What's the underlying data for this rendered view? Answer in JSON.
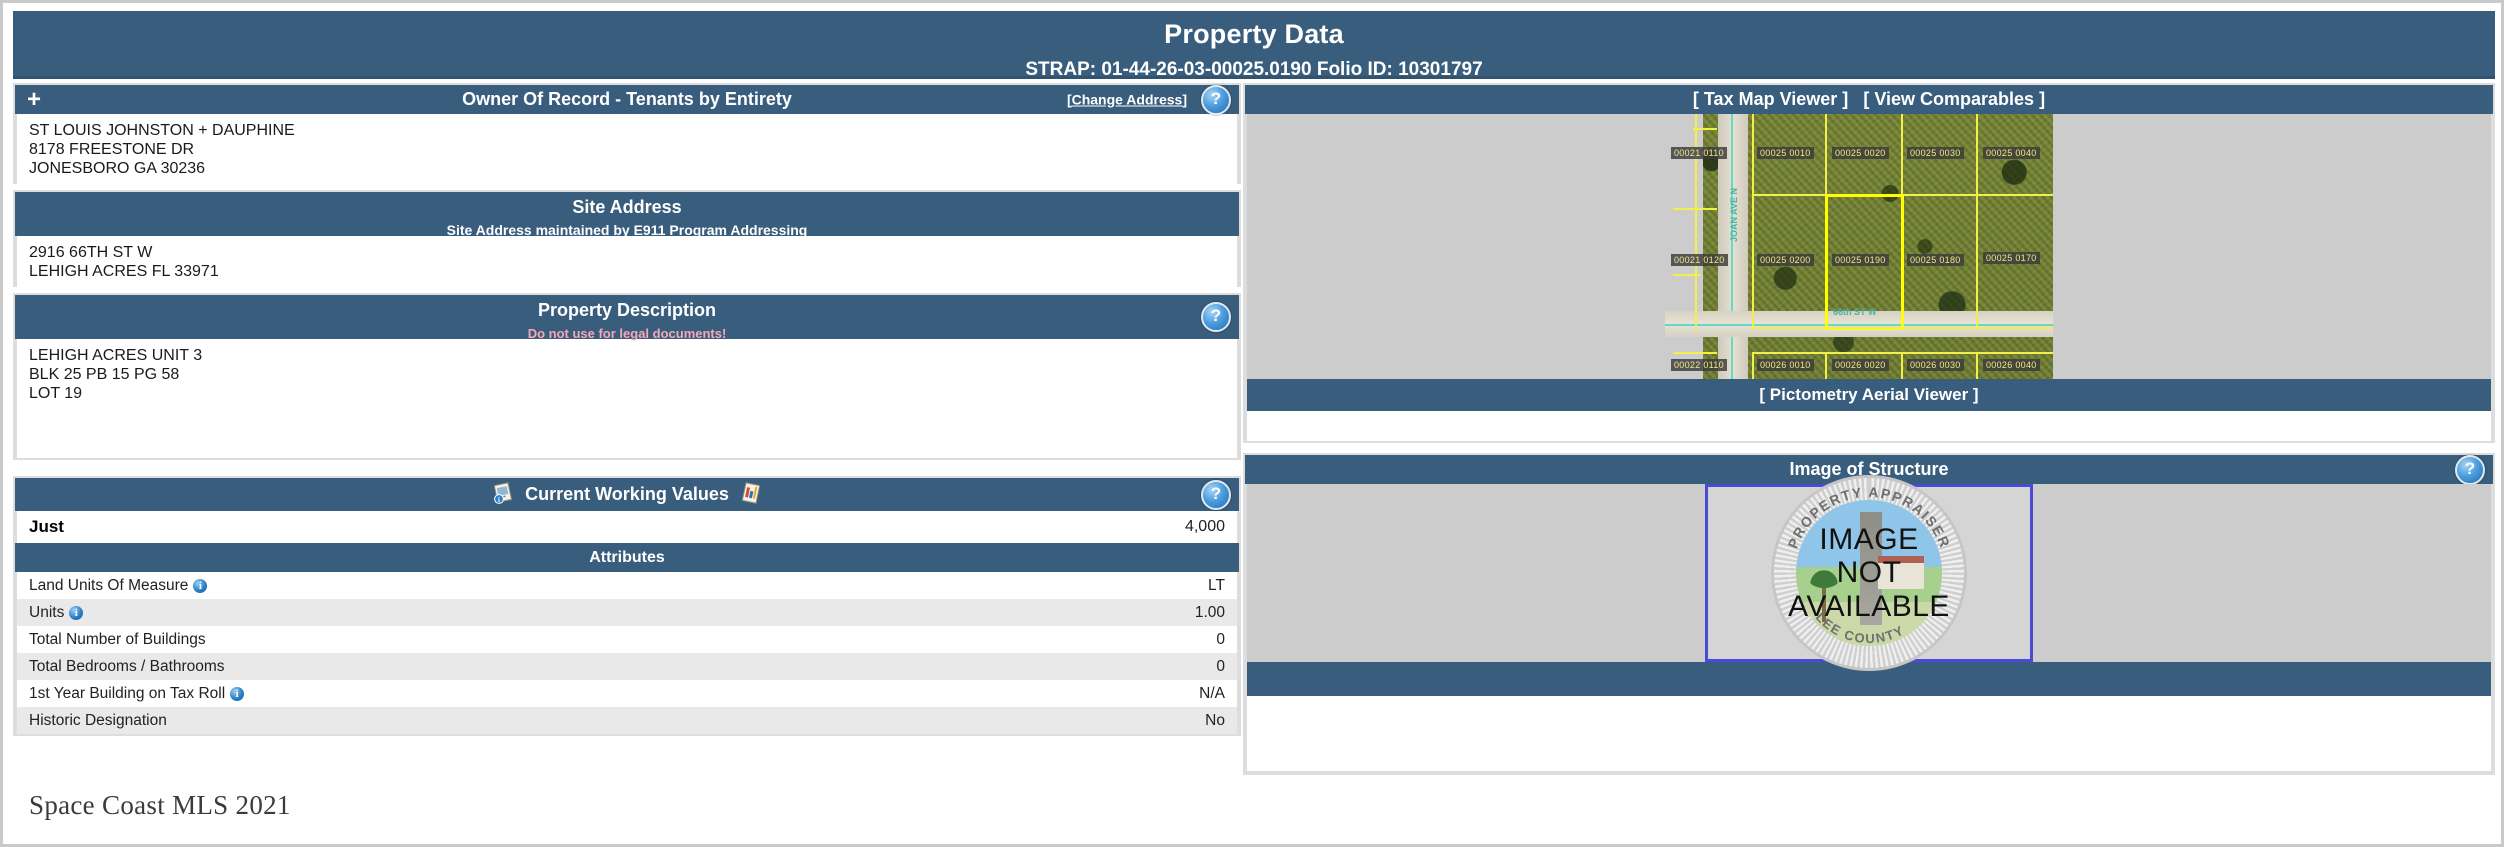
{
  "banner": {
    "title": "Property Data",
    "strap_line": "STRAP: 01-44-26-03-00025.0190  Folio ID: 10301797"
  },
  "owner": {
    "header": "Owner Of Record - Tenants by Entirety",
    "change_address_label": "[Change Address]",
    "plus_icon": "plus-icon",
    "help_icon": "?",
    "lines": [
      "ST LOUIS JOHNSTON + DAUPHINE",
      "8178 FREESTONE DR",
      "JONESBORO GA 30236"
    ]
  },
  "site_address": {
    "header": "Site Address",
    "sub_prefix": "Site Address maintained by ",
    "sub_link": "E911 Program Addressing",
    "lines": [
      "2916 66TH ST W",
      "LEHIGH ACRES FL 33971"
    ]
  },
  "property_description": {
    "header": "Property Description",
    "warning": "Do not use for legal documents!",
    "help_icon": "?",
    "lines": [
      "LEHIGH ACRES UNIT 3",
      "BLK 25 PB 15 PG 58",
      "LOT 19"
    ]
  },
  "current_working_values": {
    "header": "Current Working Values",
    "help_icon": "?",
    "just_label": "Just",
    "just_value": "4,000",
    "attributes_header": "Attributes",
    "attributes": [
      {
        "label": "Land Units Of Measure",
        "info": true,
        "value": "LT"
      },
      {
        "label": "Units",
        "info": true,
        "value": "1.00"
      },
      {
        "label": "Total Number of Buildings",
        "info": false,
        "value": "0"
      },
      {
        "label": "Total Bedrooms / Bathrooms",
        "info": false,
        "value": "0"
      },
      {
        "label": "1st Year Building on Tax Roll",
        "info": true,
        "value": "N/A"
      },
      {
        "label": "Historic Designation",
        "info": false,
        "value": "No"
      }
    ]
  },
  "map_panel": {
    "header_tax_map": "[ Tax Map Viewer ]",
    "header_comparables": "[ View Comparables ]",
    "header_combined": "[ Tax Map Viewer ] [ View Comparables ]",
    "footer": "[ Pictometry Aerial Viewer ]",
    "street_vertical": "JOAN AVE N",
    "street_horizontal": "66th ST W",
    "parcel_labels": [
      "00021 0110",
      "00025 0010",
      "00025 0020",
      "00025 0030",
      "00025 0040",
      "00021 0120",
      "00025 0200",
      "00025 0190",
      "00025 0180",
      "00025 0170",
      "00022 0110",
      "00026 0010",
      "00026 0020",
      "00026 0030",
      "00026 0040"
    ],
    "highlighted_parcel": "00025 0190"
  },
  "image_of_structure": {
    "header": "Image of Structure",
    "help_icon": "?",
    "seal_top_text": "PROPERTY APPRAISER",
    "seal_bottom_text": "LEE COUNTY",
    "overlay_lines": [
      "IMAGE",
      "NOT",
      "AVAILABLE"
    ]
  },
  "watermark": "Space Coast MLS 2021",
  "colors": {
    "header_blue": "#395d7d",
    "panel_gray": "#cccccc",
    "row_alt": "#e9e9e9",
    "warning_pink": "#f6a8b4",
    "parcel_yellow": "#ffff00",
    "struct_border": "#4a4ad6"
  }
}
